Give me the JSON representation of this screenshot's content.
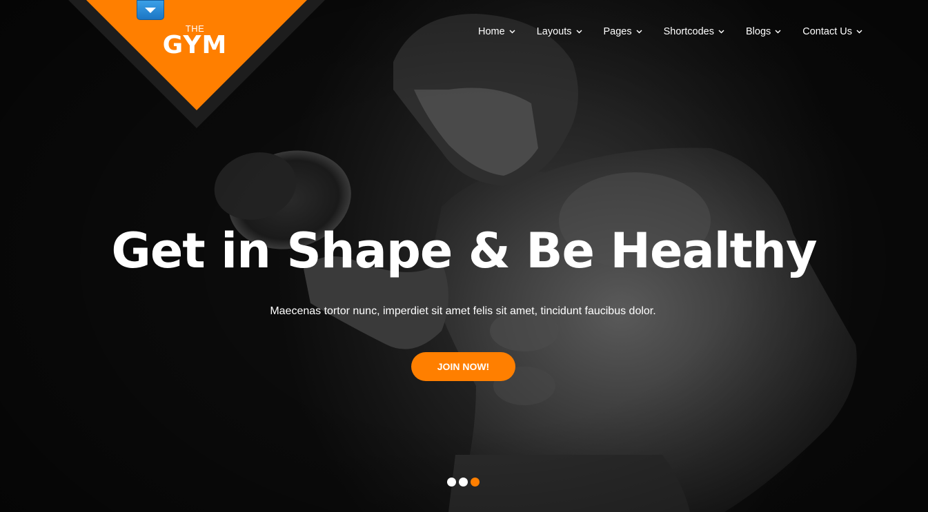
{
  "brand": {
    "the": "THE",
    "name": "GYM",
    "accent": "#ff7f00",
    "toggle_icon": "caret-down-icon"
  },
  "nav": {
    "items": [
      {
        "label": "Home"
      },
      {
        "label": "Layouts"
      },
      {
        "label": "Pages"
      },
      {
        "label": "Shortcodes"
      },
      {
        "label": "Blogs"
      },
      {
        "label": "Contact Us"
      }
    ]
  },
  "hero": {
    "headline": "Get in Shape & Be Healthy",
    "subline": "Maecenas tortor nunc, imperdiet sit amet felis sit amet, tincidunt faucibus dolor.",
    "cta": "JOIN NOW!"
  },
  "slider": {
    "count": 3,
    "active_index": 2
  }
}
